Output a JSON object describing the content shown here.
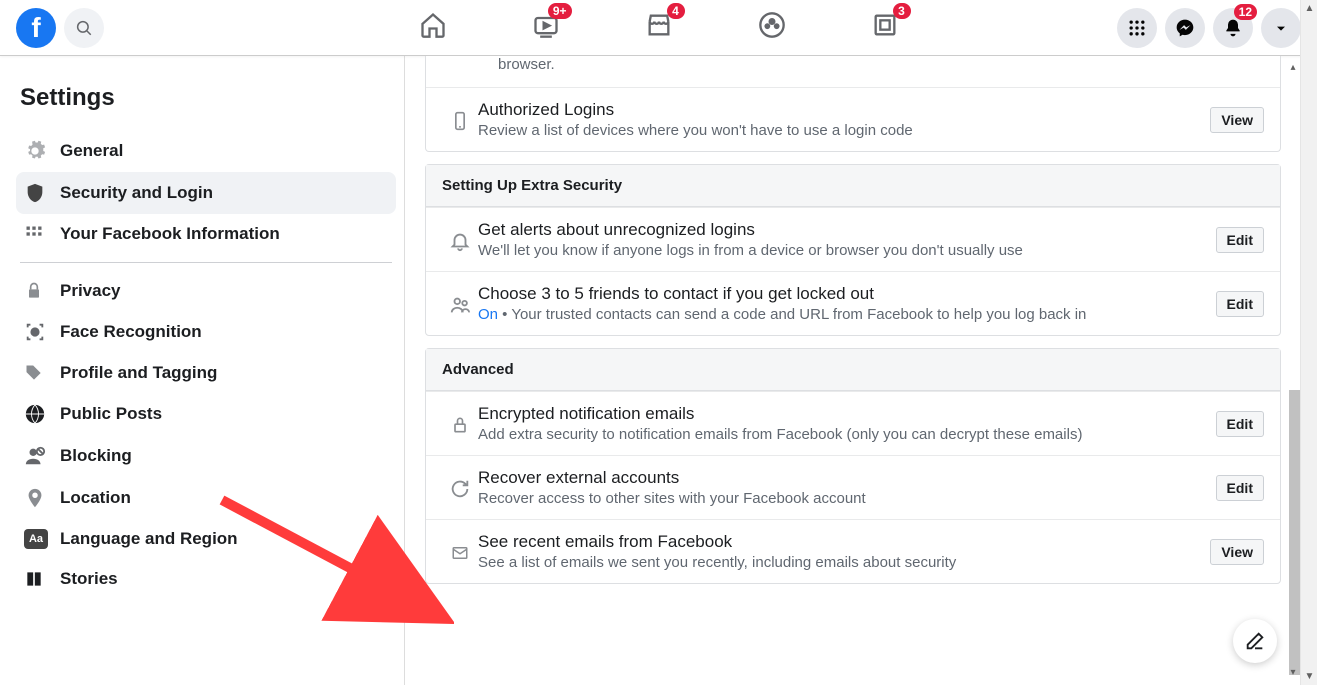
{
  "topbar": {
    "badges": {
      "watch": "9+",
      "marketplace": "4",
      "gaming": "3",
      "notifications": "12"
    }
  },
  "sidebar": {
    "title": "Settings",
    "items": [
      {
        "label": "General",
        "icon": "gear"
      },
      {
        "label": "Security and Login",
        "icon": "shield",
        "active": true
      },
      {
        "label": "Your Facebook Information",
        "icon": "grid"
      },
      {
        "label": "Privacy",
        "icon": "lock"
      },
      {
        "label": "Face Recognition",
        "icon": "face"
      },
      {
        "label": "Profile and Tagging",
        "icon": "tag"
      },
      {
        "label": "Public Posts",
        "icon": "globe"
      },
      {
        "label": "Blocking",
        "icon": "block"
      },
      {
        "label": "Location",
        "icon": "pin"
      },
      {
        "label": "Language and Region",
        "icon": "aa"
      },
      {
        "label": "Stories",
        "icon": "book"
      }
    ]
  },
  "main": {
    "partial_row_desc": "browser.",
    "sections": [
      {
        "rows": [
          {
            "icon": "phone",
            "title": "Authorized Logins",
            "desc": "Review a list of devices where you won't have to use a login code",
            "action": "View"
          }
        ]
      },
      {
        "header": "Setting Up Extra Security",
        "rows": [
          {
            "icon": "bell",
            "title": "Get alerts about unrecognized logins",
            "desc": "We'll let you know if anyone logs in from a device or browser you don't usually use",
            "action": "Edit"
          },
          {
            "icon": "friends",
            "title": "Choose 3 to 5 friends to contact if you get locked out",
            "status": "On",
            "desc": " • Your trusted contacts can send a code and URL from Facebook to help you log back in",
            "action": "Edit"
          }
        ]
      },
      {
        "header": "Advanced",
        "rows": [
          {
            "icon": "lock",
            "title": "Encrypted notification emails",
            "desc": "Add extra security to notification emails from Facebook (only you can decrypt these emails)",
            "action": "Edit"
          },
          {
            "icon": "refresh",
            "title": "Recover external accounts",
            "desc": "Recover access to other sites with your Facebook account",
            "action": "Edit"
          },
          {
            "icon": "mail",
            "title": "See recent emails from Facebook",
            "desc": "See a list of emails we sent you recently, including emails about security",
            "action": "View"
          }
        ]
      }
    ]
  }
}
